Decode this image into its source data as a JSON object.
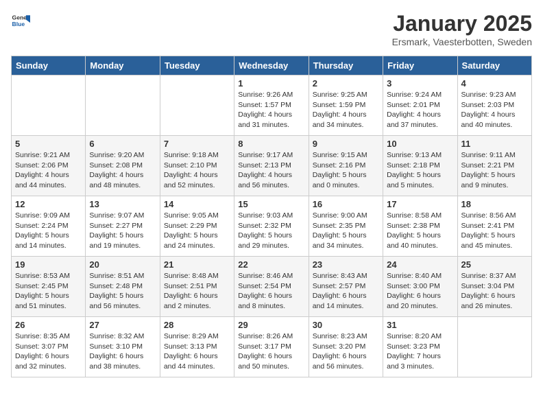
{
  "header": {
    "logo_general": "General",
    "logo_blue": "Blue",
    "title": "January 2025",
    "subtitle": "Ersmark, Vaesterbotten, Sweden"
  },
  "weekdays": [
    "Sunday",
    "Monday",
    "Tuesday",
    "Wednesday",
    "Thursday",
    "Friday",
    "Saturday"
  ],
  "weeks": [
    [
      {
        "day": "",
        "detail": ""
      },
      {
        "day": "",
        "detail": ""
      },
      {
        "day": "",
        "detail": ""
      },
      {
        "day": "1",
        "detail": "Sunrise: 9:26 AM\nSunset: 1:57 PM\nDaylight: 4 hours\nand 31 minutes."
      },
      {
        "day": "2",
        "detail": "Sunrise: 9:25 AM\nSunset: 1:59 PM\nDaylight: 4 hours\nand 34 minutes."
      },
      {
        "day": "3",
        "detail": "Sunrise: 9:24 AM\nSunset: 2:01 PM\nDaylight: 4 hours\nand 37 minutes."
      },
      {
        "day": "4",
        "detail": "Sunrise: 9:23 AM\nSunset: 2:03 PM\nDaylight: 4 hours\nand 40 minutes."
      }
    ],
    [
      {
        "day": "5",
        "detail": "Sunrise: 9:21 AM\nSunset: 2:06 PM\nDaylight: 4 hours\nand 44 minutes."
      },
      {
        "day": "6",
        "detail": "Sunrise: 9:20 AM\nSunset: 2:08 PM\nDaylight: 4 hours\nand 48 minutes."
      },
      {
        "day": "7",
        "detail": "Sunrise: 9:18 AM\nSunset: 2:10 PM\nDaylight: 4 hours\nand 52 minutes."
      },
      {
        "day": "8",
        "detail": "Sunrise: 9:17 AM\nSunset: 2:13 PM\nDaylight: 4 hours\nand 56 minutes."
      },
      {
        "day": "9",
        "detail": "Sunrise: 9:15 AM\nSunset: 2:16 PM\nDaylight: 5 hours\nand 0 minutes."
      },
      {
        "day": "10",
        "detail": "Sunrise: 9:13 AM\nSunset: 2:18 PM\nDaylight: 5 hours\nand 5 minutes."
      },
      {
        "day": "11",
        "detail": "Sunrise: 9:11 AM\nSunset: 2:21 PM\nDaylight: 5 hours\nand 9 minutes."
      }
    ],
    [
      {
        "day": "12",
        "detail": "Sunrise: 9:09 AM\nSunset: 2:24 PM\nDaylight: 5 hours\nand 14 minutes."
      },
      {
        "day": "13",
        "detail": "Sunrise: 9:07 AM\nSunset: 2:27 PM\nDaylight: 5 hours\nand 19 minutes."
      },
      {
        "day": "14",
        "detail": "Sunrise: 9:05 AM\nSunset: 2:29 PM\nDaylight: 5 hours\nand 24 minutes."
      },
      {
        "day": "15",
        "detail": "Sunrise: 9:03 AM\nSunset: 2:32 PM\nDaylight: 5 hours\nand 29 minutes."
      },
      {
        "day": "16",
        "detail": "Sunrise: 9:00 AM\nSunset: 2:35 PM\nDaylight: 5 hours\nand 34 minutes."
      },
      {
        "day": "17",
        "detail": "Sunrise: 8:58 AM\nSunset: 2:38 PM\nDaylight: 5 hours\nand 40 minutes."
      },
      {
        "day": "18",
        "detail": "Sunrise: 8:56 AM\nSunset: 2:41 PM\nDaylight: 5 hours\nand 45 minutes."
      }
    ],
    [
      {
        "day": "19",
        "detail": "Sunrise: 8:53 AM\nSunset: 2:45 PM\nDaylight: 5 hours\nand 51 minutes."
      },
      {
        "day": "20",
        "detail": "Sunrise: 8:51 AM\nSunset: 2:48 PM\nDaylight: 5 hours\nand 56 minutes."
      },
      {
        "day": "21",
        "detail": "Sunrise: 8:48 AM\nSunset: 2:51 PM\nDaylight: 6 hours\nand 2 minutes."
      },
      {
        "day": "22",
        "detail": "Sunrise: 8:46 AM\nSunset: 2:54 PM\nDaylight: 6 hours\nand 8 minutes."
      },
      {
        "day": "23",
        "detail": "Sunrise: 8:43 AM\nSunset: 2:57 PM\nDaylight: 6 hours\nand 14 minutes."
      },
      {
        "day": "24",
        "detail": "Sunrise: 8:40 AM\nSunset: 3:00 PM\nDaylight: 6 hours\nand 20 minutes."
      },
      {
        "day": "25",
        "detail": "Sunrise: 8:37 AM\nSunset: 3:04 PM\nDaylight: 6 hours\nand 26 minutes."
      }
    ],
    [
      {
        "day": "26",
        "detail": "Sunrise: 8:35 AM\nSunset: 3:07 PM\nDaylight: 6 hours\nand 32 minutes."
      },
      {
        "day": "27",
        "detail": "Sunrise: 8:32 AM\nSunset: 3:10 PM\nDaylight: 6 hours\nand 38 minutes."
      },
      {
        "day": "28",
        "detail": "Sunrise: 8:29 AM\nSunset: 3:13 PM\nDaylight: 6 hours\nand 44 minutes."
      },
      {
        "day": "29",
        "detail": "Sunrise: 8:26 AM\nSunset: 3:17 PM\nDaylight: 6 hours\nand 50 minutes."
      },
      {
        "day": "30",
        "detail": "Sunrise: 8:23 AM\nSunset: 3:20 PM\nDaylight: 6 hours\nand 56 minutes."
      },
      {
        "day": "31",
        "detail": "Sunrise: 8:20 AM\nSunset: 3:23 PM\nDaylight: 7 hours\nand 3 minutes."
      },
      {
        "day": "",
        "detail": ""
      }
    ]
  ]
}
